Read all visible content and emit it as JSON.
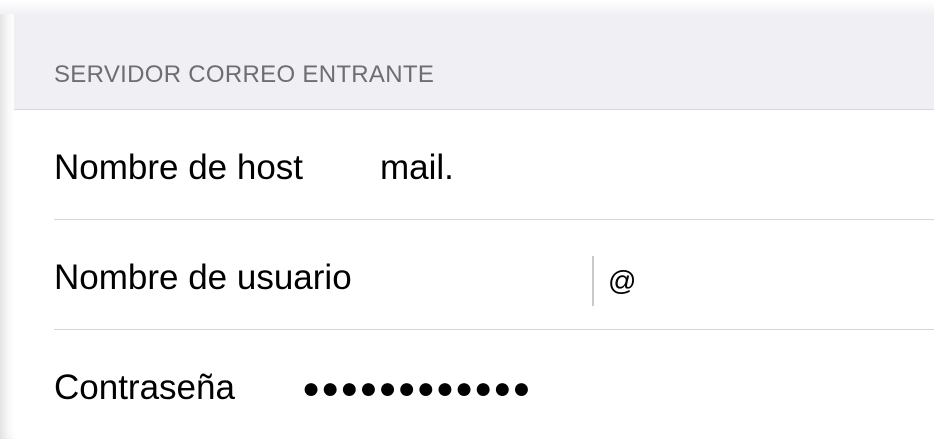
{
  "section": {
    "title": "SERVIDOR CORREO ENTRANTE"
  },
  "rows": [
    {
      "label": "Nombre de host",
      "value": "mail."
    },
    {
      "label": "Nombre de usuario",
      "value": "@"
    },
    {
      "label": "Contraseña",
      "value": "●●●●●●●●●●●●"
    }
  ]
}
